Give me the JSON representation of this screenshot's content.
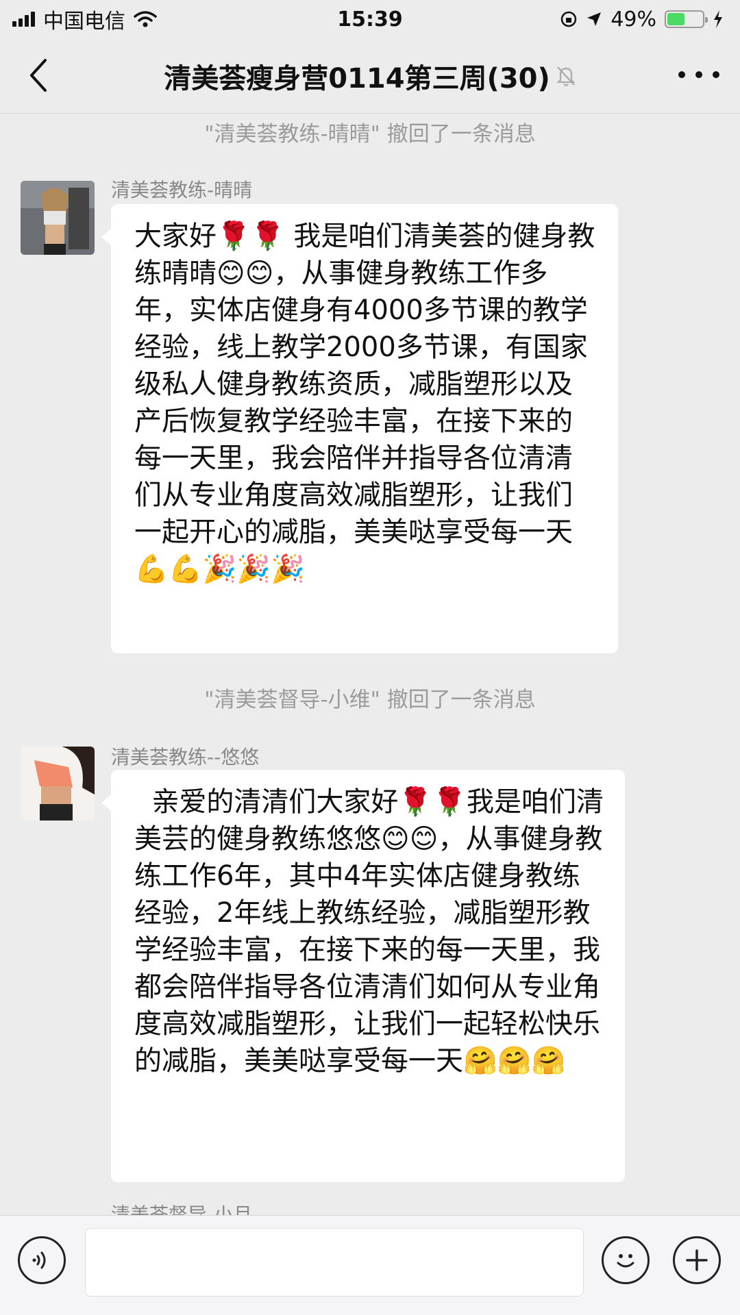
{
  "status_bar": {
    "carrier": "中国电信",
    "time": "15:39",
    "battery": "49%",
    "battery_level": 0.49
  },
  "nav": {
    "title": "清美荟瘦身营0114第三周(30)"
  },
  "messages": [
    {
      "type": "system",
      "text": "\"清美荟教练-晴晴\" 撤回了一条消息"
    },
    {
      "type": "chat",
      "sender": "清美荟教练-晴晴",
      "text": "大家好🌹🌹 我是咱们清美荟的健身教练晴晴😊😊，从事健身教练工作多年，实体店健身有4000多节课的教学经验，线上教学2000多节课，有国家级私人健身教练资质，减脂塑形以及产后恢复教学经验丰富，在接下来的每一天里，我会陪伴并指导各位清清们从专业角度高效减脂塑形，让我们一起开心的减脂，美美哒享受每一天💪💪🎉🎉🎉"
    },
    {
      "type": "system",
      "text": "\"清美荟督导-小维\" 撤回了一条消息"
    },
    {
      "type": "chat",
      "sender": "清美荟教练--悠悠",
      "text": "  亲爱的清清们大家好🌹🌹我是咱们清美芸的健身教练悠悠😊😊，从事健身教练工作6年，其中4年实体店健身教练经验，2年线上教练经验，减脂塑形教学经验丰富，在接下来的每一天里，我都会陪伴指导各位清清们如何从专业角度高效减脂塑形，让我们一起轻松快乐的减脂，美美哒享受每一天🤗🤗🤗"
    }
  ],
  "next_sender_partial": "清美荟督导-小月",
  "input": {
    "value": "",
    "placeholder": ""
  },
  "icons": {
    "back": "chevron-left-icon",
    "mute": "bell-slash-icon",
    "more": "more-dots-icon",
    "voice": "voice-icon",
    "emoji": "emoji-icon",
    "plus": "plus-icon"
  }
}
